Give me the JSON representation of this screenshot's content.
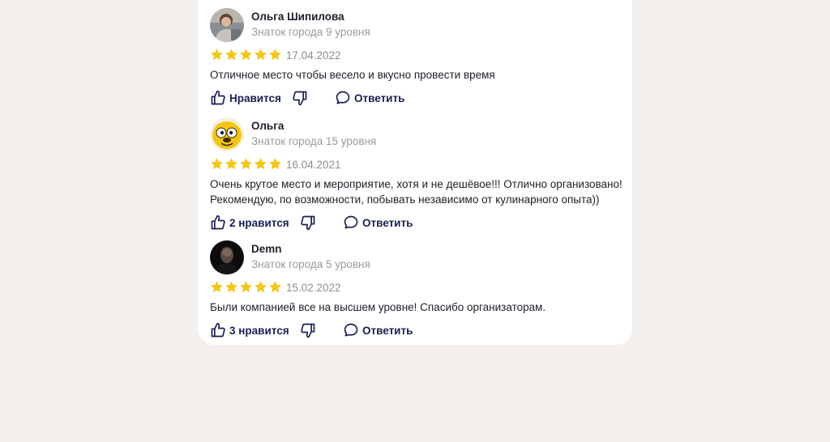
{
  "reviews": [
    {
      "author": "Ольга Шипилова",
      "level": "Знаток города 9 уровня",
      "rating": 5,
      "date": "17.04.2022",
      "text": "Отличное место чтобы весело и вкусно провести время",
      "like_label": "Нравится",
      "reply_label": "Ответить",
      "avatar_icon": "photo-avatar"
    },
    {
      "author": "Ольга",
      "level": "Знаток города 15 уровня",
      "rating": 5,
      "date": "16.04.2021",
      "text": "Очень крутое место и мероприятие, хотя и не дешёвое!!! Отлично организовано! Рекомендую, по возможности, побывать независимо от кулинарного опыта))",
      "like_label": "2 нравится",
      "reply_label": "Ответить",
      "avatar_icon": "cartoon-dog-avatar"
    },
    {
      "author": "Demn",
      "level": "Знаток города 5 уровня",
      "rating": 5,
      "date": "15.02.2022",
      "text": "Были компанией все на высшем уровне! Спасибо организаторам.",
      "like_label": "3 нравится",
      "reply_label": "Ответить",
      "avatar_icon": "dark-photo-avatar"
    }
  ],
  "colors": {
    "star": "#f5c518",
    "action": "#1a1f54",
    "background": "#f2efec"
  }
}
